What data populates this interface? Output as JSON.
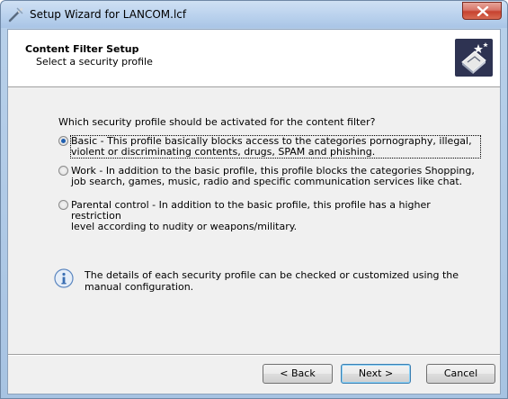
{
  "window": {
    "title": "Setup Wizard for LANCOM.lcf"
  },
  "header": {
    "title": "Content Filter Setup",
    "subtitle": "Select a security profile"
  },
  "content": {
    "question": "Which security profile should be activated for the content filter?",
    "options": [
      {
        "line1": "Basic - This profile basically blocks access to the categories pornography, illegal,",
        "line2": "violent or discriminating contents, drugs, SPAM and phishing.",
        "selected": true
      },
      {
        "line1": "Work - In addition to the basic profile, this profile blocks the categories Shopping,",
        "line2": "job search, games, music, radio and specific communication services like chat.",
        "selected": false
      },
      {
        "line1": "Parental control - In addition to the basic profile, this profile has a higher restriction",
        "line2": "level according to nudity or weapons/military.",
        "selected": false
      }
    ],
    "info_line1": "The details of each security profile can be checked or customized using the",
    "info_line2": "manual configuration."
  },
  "buttons": {
    "back": "< Back",
    "next": "Next >",
    "cancel": "Cancel"
  },
  "icons": {
    "title_icon": "wizard-wand-icon",
    "header_icon": "wizard-hat-icon",
    "info_icon": "info-icon",
    "close_icon": "close-icon"
  },
  "colors": {
    "selected_radio": "#1f5fb0",
    "close_button": "#c6422f"
  }
}
